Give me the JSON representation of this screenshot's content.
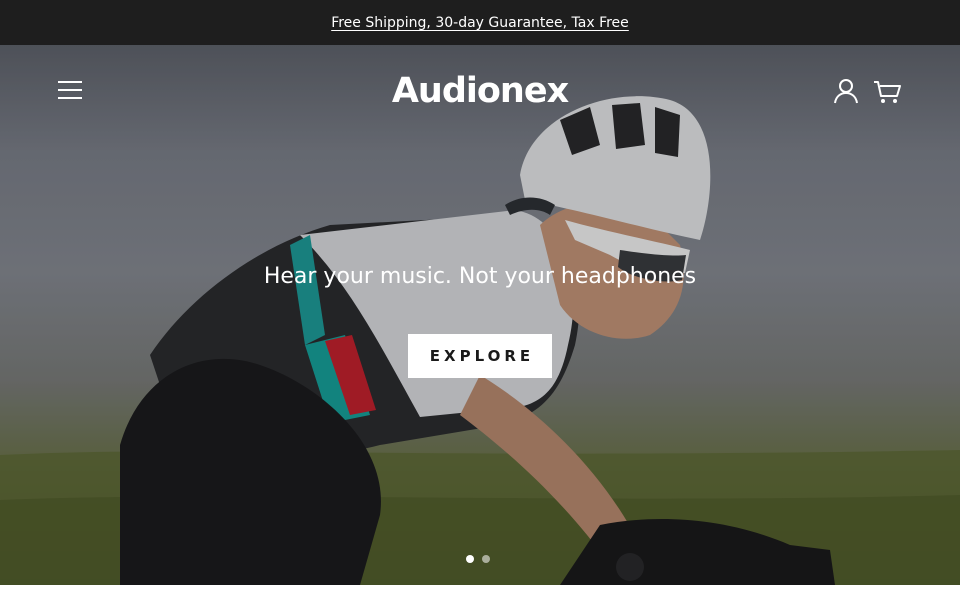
{
  "announcement": {
    "text": "Free Shipping, 30-day Guarantee, Tax Free"
  },
  "header": {
    "logo": "Audionex",
    "menu_icon": "hamburger-menu-icon",
    "account_icon": "user-account-icon",
    "cart_icon": "shopping-cart-icon"
  },
  "hero": {
    "headline": "Hear your music. Not your headphones",
    "cta_label": "EXPLORE",
    "slides_total": 2,
    "active_slide": 1
  },
  "colors": {
    "announcement_bg": "#1e1e1e",
    "text_on_hero": "#ffffff",
    "cta_bg": "#ffffff",
    "cta_text": "#1a1a1a"
  }
}
